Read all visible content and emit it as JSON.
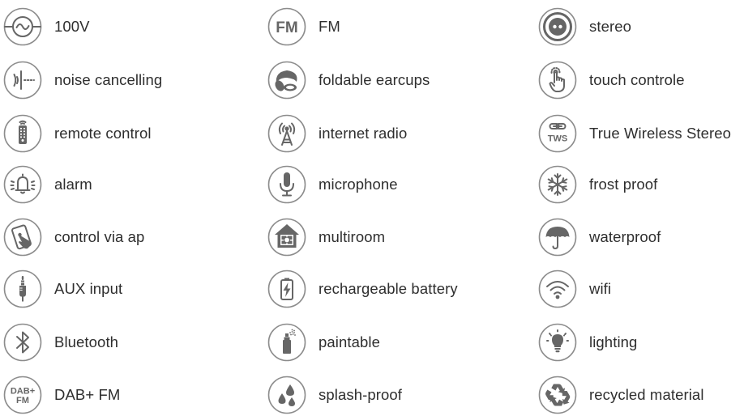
{
  "columns": [
    {
      "items": [
        {
          "label": "100V",
          "icon": "ac-power-icon"
        },
        {
          "label": "noise cancelling",
          "icon": "noise-cancelling-icon"
        },
        {
          "label": "remote control",
          "icon": "remote-control-icon"
        },
        {
          "label": "alarm",
          "icon": "alarm-bell-icon"
        },
        {
          "label": "control via ap",
          "icon": "phone-touch-icon"
        },
        {
          "label": "AUX input",
          "icon": "aux-jack-icon"
        },
        {
          "label": "Bluetooth",
          "icon": "bluetooth-icon"
        },
        {
          "label": "DAB+ FM",
          "icon": "dab-fm-icon"
        }
      ]
    },
    {
      "items": [
        {
          "label": "FM",
          "icon": "fm-icon"
        },
        {
          "label": "foldable earcups",
          "icon": "headphones-icon"
        },
        {
          "label": "internet radio",
          "icon": "radio-tower-icon"
        },
        {
          "label": "microphone",
          "icon": "microphone-icon"
        },
        {
          "label": "multiroom",
          "icon": "multiroom-house-icon"
        },
        {
          "label": "rechargeable battery",
          "icon": "battery-icon"
        },
        {
          "label": "paintable",
          "icon": "spray-can-icon"
        },
        {
          "label": "splash-proof",
          "icon": "water-drops-icon"
        }
      ]
    },
    {
      "items": [
        {
          "label": "stereo",
          "icon": "stereo-icon"
        },
        {
          "label": "touch controle",
          "icon": "touch-hand-icon"
        },
        {
          "label": "True Wireless Stereo",
          "icon": "tws-link-icon"
        },
        {
          "label": "frost proof",
          "icon": "snowflake-icon"
        },
        {
          "label": "waterproof",
          "icon": "umbrella-icon"
        },
        {
          "label": "wifi",
          "icon": "wifi-icon"
        },
        {
          "label": "lighting",
          "icon": "light-bulb-icon"
        },
        {
          "label": "recycled material",
          "icon": "recycle-icon"
        }
      ]
    }
  ],
  "icon_texts": {
    "fm": "FM",
    "dab_top": "DAB+",
    "dab_bottom": "FM",
    "tws": "TWS"
  },
  "colors": {
    "icon_ring": "#8c8c8c",
    "icon_glyph": "#666666",
    "label_text": "#2e2e2e",
    "background": "#ffffff"
  }
}
